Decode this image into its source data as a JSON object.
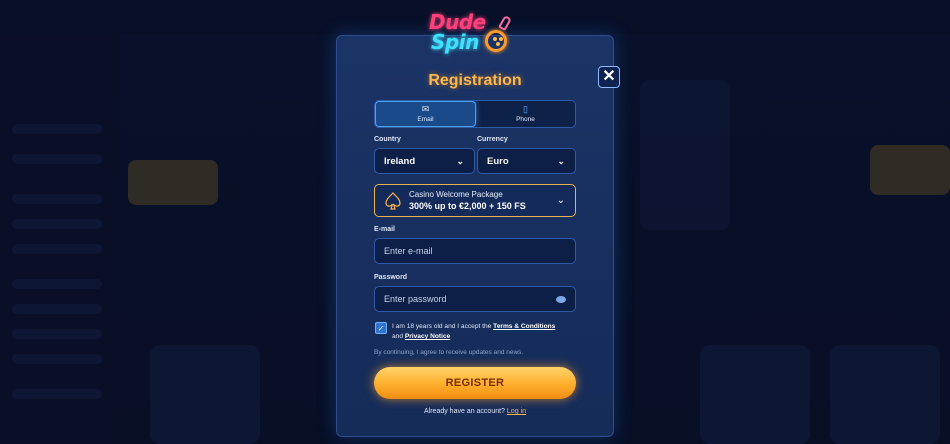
{
  "brand": {
    "line1": "Dude",
    "line2": "Spin"
  },
  "modal": {
    "title": "Registration",
    "close_label": "✕"
  },
  "tabs": [
    {
      "label": "Email",
      "icon": "envelope-icon",
      "glyph": "✉",
      "active": true
    },
    {
      "label": "Phone",
      "icon": "phone-icon",
      "glyph": "▯",
      "active": false
    }
  ],
  "country": {
    "label": "Country",
    "value": "Ireland"
  },
  "currency": {
    "label": "Currency",
    "value": "Euro"
  },
  "bonus": {
    "title": "Casino Welcome Package",
    "offer": "300% up to €2,000 + 150 FS"
  },
  "email": {
    "label": "E-mail",
    "placeholder": "Enter e-mail"
  },
  "password": {
    "label": "Password",
    "placeholder": "Enter password"
  },
  "terms": {
    "checked": true,
    "text1": "I am 18 years old and I accept the ",
    "link1": "Terms & Conditions",
    "text2": " and ",
    "link2": "Privacy Notice"
  },
  "notice": "By continuing, I agree to receive updates and news.",
  "register_label": "REGISTER",
  "login": {
    "prompt": "Already have an account?",
    "link": "Log in"
  },
  "colors": {
    "accent": "#ffb64a",
    "border": "#2f5aa8",
    "bonus_border": "#e8b34a"
  }
}
